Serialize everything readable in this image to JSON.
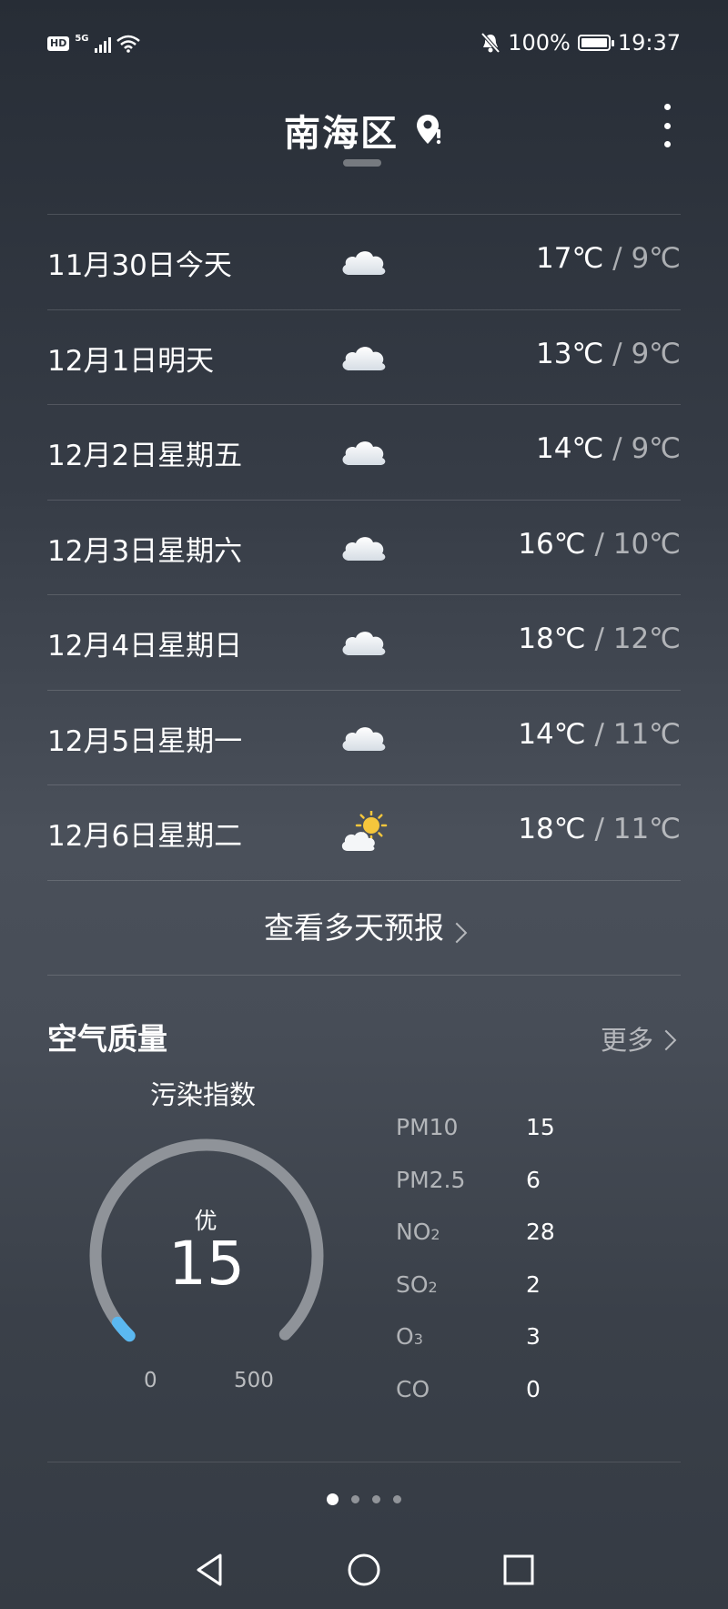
{
  "status_bar": {
    "hd": "HD",
    "network": "5G",
    "battery": "100%",
    "time": "19:37",
    "icons": [
      "signal-icon",
      "wifi-icon",
      "mute-bell-icon",
      "battery-icon"
    ]
  },
  "header": {
    "title": "南海区",
    "location_icon": "location-pin-icon",
    "menu_icon": "more-vertical-icon"
  },
  "forecast": {
    "days": [
      {
        "label": "11月30日今天",
        "icon": "cloud-icon",
        "high": "17℃",
        "low": "9℃"
      },
      {
        "label": "12月1日明天",
        "icon": "cloud-icon",
        "high": "13℃",
        "low": "9℃"
      },
      {
        "label": "12月2日星期五",
        "icon": "cloud-icon",
        "high": "14℃",
        "low": "9℃"
      },
      {
        "label": "12月3日星期六",
        "icon": "cloud-icon",
        "high": "16℃",
        "low": "10℃"
      },
      {
        "label": "12月4日星期日",
        "icon": "cloud-icon",
        "high": "18℃",
        "low": "12℃"
      },
      {
        "label": "12月5日星期一",
        "icon": "cloud-icon",
        "high": "14℃",
        "low": "11℃"
      },
      {
        "label": "12月6日星期二",
        "icon": "partly-sunny-icon",
        "high": "18℃",
        "low": "11℃"
      }
    ],
    "separator": "/",
    "more_label": "查看多天预报"
  },
  "air_quality": {
    "title": "空气质量",
    "more_label": "更多",
    "gauge_label": "污染指数",
    "grade": "优",
    "aqi": "15",
    "min": "0",
    "max": "500",
    "aqi_fraction": 0.03,
    "gauge_color": "#5bb8f0",
    "pollutants": [
      {
        "name": "PM10",
        "sub": "",
        "value": "15"
      },
      {
        "name": "PM2.5",
        "sub": "",
        "value": "6"
      },
      {
        "name": "NO",
        "sub": "2",
        "value": "28"
      },
      {
        "name": "SO",
        "sub": "2",
        "value": "2"
      },
      {
        "name": "O",
        "sub": "3",
        "value": "3"
      },
      {
        "name": "CO",
        "sub": "",
        "value": "0"
      }
    ]
  },
  "pager": {
    "count": 4,
    "active": 0
  },
  "nav": {
    "buttons": [
      "back-icon",
      "home-icon",
      "recents-icon"
    ]
  }
}
